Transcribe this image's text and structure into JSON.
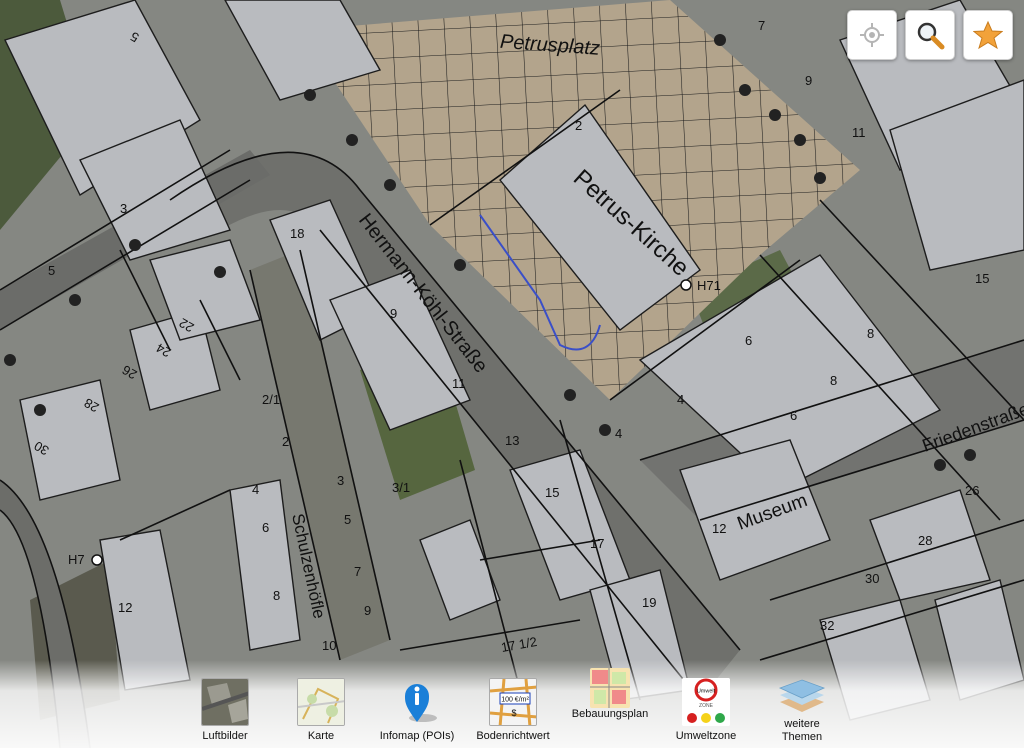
{
  "map": {
    "street_labels": [
      "Petrusplatz",
      "Hermann-Köhl-Straße",
      "Schulzenhöfle",
      "Friedenstraße"
    ],
    "building_labels": [
      "Petrus-Kirche",
      "Museum"
    ],
    "stop_labels": [
      "H71",
      "H7"
    ],
    "house_numbers": [
      "5",
      "7",
      "9",
      "11",
      "15",
      "2",
      "3",
      "4",
      "5",
      "6",
      "8",
      "18",
      "22",
      "24",
      "26",
      "28",
      "30",
      "9",
      "11",
      "13",
      "15",
      "17",
      "19",
      "12",
      "2/1",
      "2",
      "4",
      "6",
      "8",
      "10",
      "3",
      "3/1",
      "5",
      "7",
      "9",
      "17 1/2",
      "32",
      "30",
      "28",
      "26",
      "12",
      "4",
      "8",
      "6"
    ]
  },
  "controls": {
    "locate": {
      "icon": "crosshair-icon"
    },
    "search": {
      "icon": "magnifier-icon"
    },
    "favorites": {
      "icon": "star-icon",
      "color": "#f2a23a"
    }
  },
  "themes": [
    {
      "label": "Luftbilder",
      "icon": "aerial-photo-icon"
    },
    {
      "label": "Karte",
      "icon": "map-icon"
    },
    {
      "label": "Infomap (POIs)",
      "icon": "info-pin-icon"
    },
    {
      "label": "Bodenrichtwert",
      "icon": "land-value-icon",
      "sign": "100 €/m²"
    },
    {
      "label": "Bebauungsplan",
      "icon": "zoning-plan-icon"
    },
    {
      "label": "Umweltzone",
      "icon": "environmental-zone-icon",
      "sign": "Umwelt"
    },
    {
      "label": "weitere Themen",
      "icon": "layers-icon"
    }
  ],
  "colors": {
    "accent": "#f2a23a",
    "info": "#1a7fd8"
  }
}
